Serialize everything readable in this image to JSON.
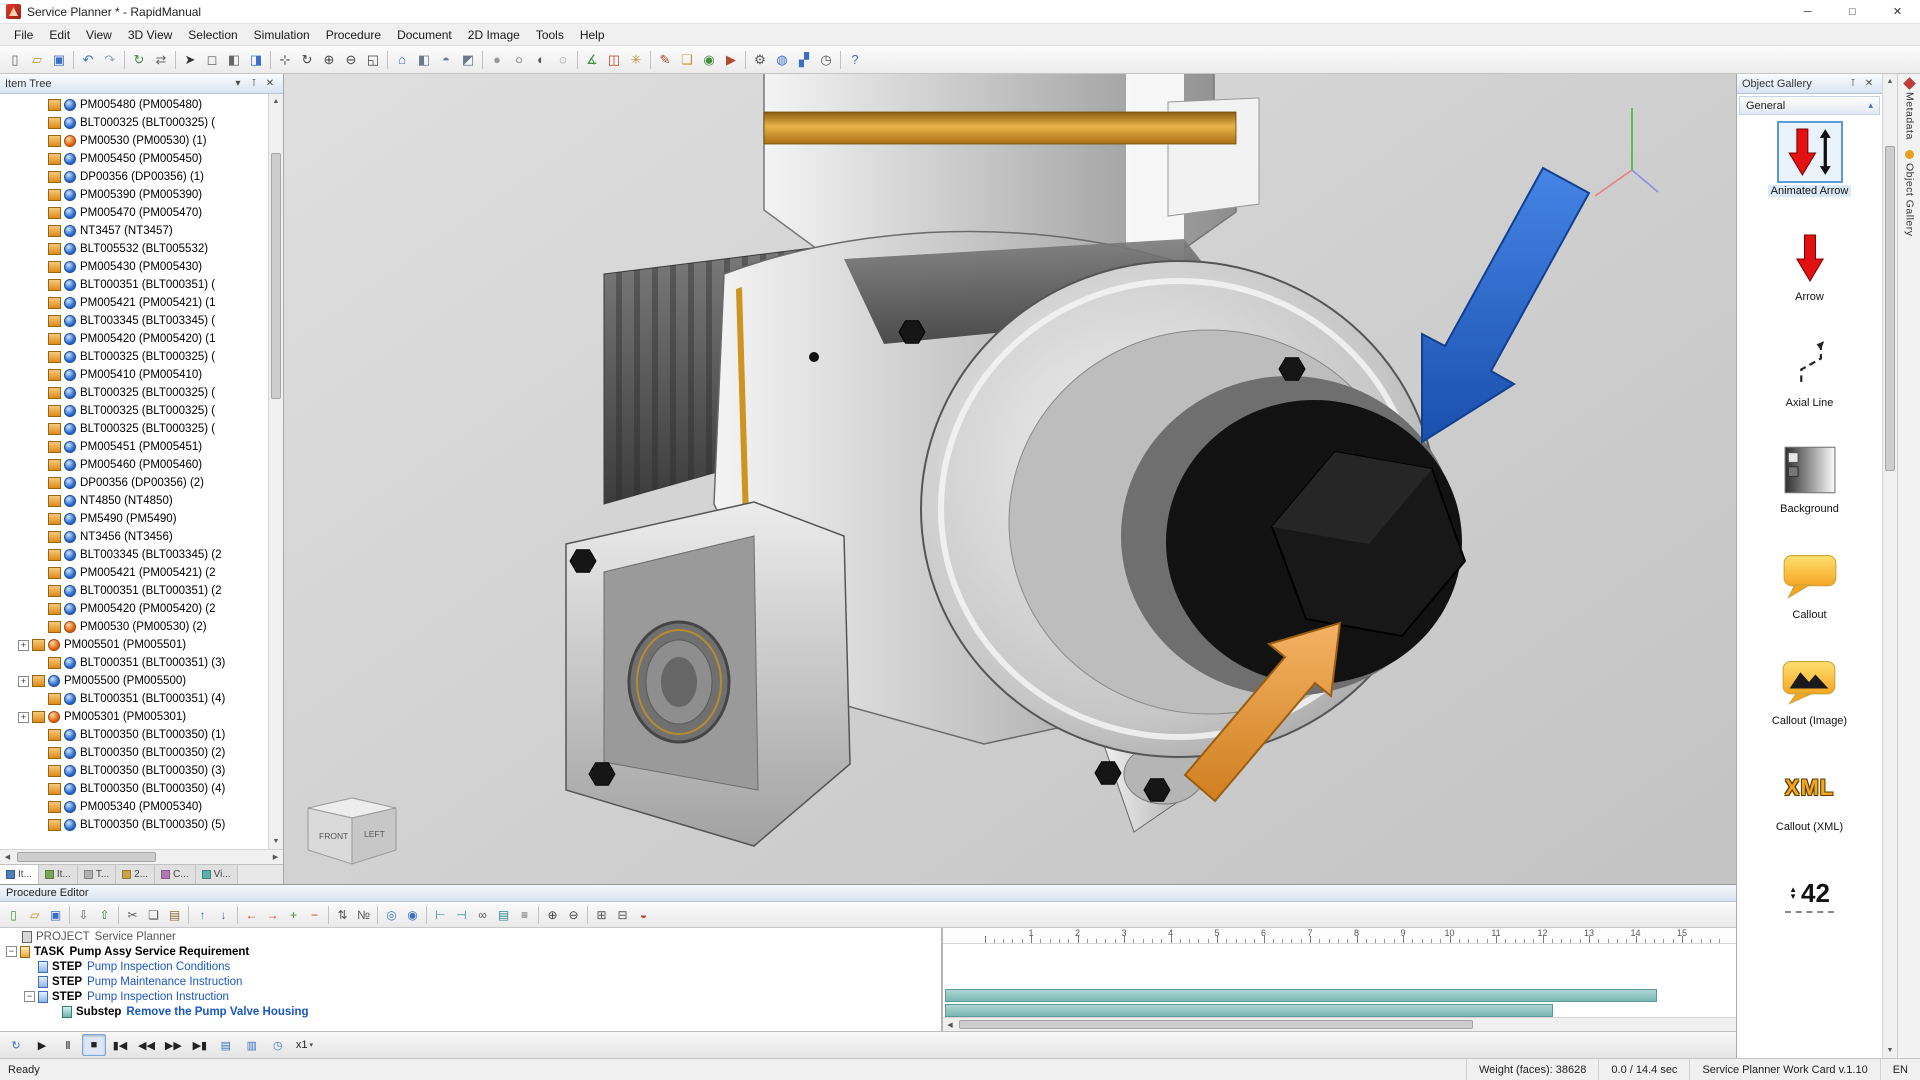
{
  "window": {
    "title": "Service Planner * - RapidManual",
    "controls": {
      "minimize": "─",
      "maximize": "□",
      "close": "✕"
    }
  },
  "menu": {
    "items": [
      "File",
      "Edit",
      "View",
      "3D View",
      "Selection",
      "Simulation",
      "Procedure",
      "Document",
      "2D Image",
      "Tools",
      "Help"
    ]
  },
  "main_toolbar": {
    "icons": [
      {
        "n": "new-document",
        "g": "▯",
        "c": "#666"
      },
      {
        "n": "open-file",
        "g": "▱",
        "c": "#c79136"
      },
      {
        "n": "save",
        "g": "▣",
        "c": "#3b6fc4"
      },
      {
        "sep": true
      },
      {
        "n": "undo",
        "g": "↶",
        "c": "#3b6fc4"
      },
      {
        "n": "redo",
        "g": "↷",
        "c": "#9aa7b8"
      },
      {
        "sep": true
      },
      {
        "n": "refresh",
        "g": "↻",
        "c": "#3f8f3f"
      },
      {
        "n": "sync",
        "g": "⇄",
        "c": "#666"
      },
      {
        "sep": true
      },
      {
        "n": "select-cursor",
        "g": "➤",
        "c": "#333"
      },
      {
        "n": "select-rectangle",
        "g": "◻",
        "c": "#666"
      },
      {
        "n": "select-group",
        "g": "◧",
        "c": "#666"
      },
      {
        "n": "select-by-color",
        "g": "◨",
        "c": "#3b6fc4"
      },
      {
        "sep": true
      },
      {
        "n": "pan",
        "g": "⊹",
        "c": "#444"
      },
      {
        "n": "orbit",
        "g": "↻",
        "c": "#444"
      },
      {
        "n": "zoom-in",
        "g": "⊕",
        "c": "#444"
      },
      {
        "n": "zoom-out",
        "g": "⊖",
        "c": "#444"
      },
      {
        "n": "zoom-fit",
        "g": "◱",
        "c": "#444"
      },
      {
        "sep": true
      },
      {
        "n": "view-home",
        "g": "⌂",
        "c": "#3b6fc4"
      },
      {
        "n": "view-front",
        "g": "◧",
        "c": "#6a7a8a"
      },
      {
        "n": "view-top",
        "g": "◓",
        "c": "#6a7a8a"
      },
      {
        "n": "view-iso",
        "g": "◩",
        "c": "#6a7a8a"
      },
      {
        "sep": true
      },
      {
        "n": "render-shaded",
        "g": "●",
        "c": "#9a9a9a"
      },
      {
        "n": "render-wireframe",
        "g": "○",
        "c": "#555"
      },
      {
        "n": "render-hidden-line",
        "g": "◐",
        "c": "#555"
      },
      {
        "n": "render-transparent",
        "g": "◌",
        "c": "#555"
      },
      {
        "sep": true
      },
      {
        "n": "measure",
        "g": "∡",
        "c": "#3f8f3f"
      },
      {
        "n": "section",
        "g": "◫",
        "c": "#b5482a"
      },
      {
        "n": "explode",
        "g": "✳",
        "c": "#c79136"
      },
      {
        "sep": true
      },
      {
        "n": "annotate",
        "g": "✎",
        "c": "#b5482a"
      },
      {
        "n": "callout",
        "g": "❏",
        "c": "#c79136"
      },
      {
        "n": "snapshot",
        "g": "◉",
        "c": "#3f8f3f"
      },
      {
        "n": "record-video",
        "g": "▶",
        "c": "#b5482a"
      },
      {
        "sep": true
      },
      {
        "n": "settings",
        "g": "⚙",
        "c": "#555"
      },
      {
        "n": "world",
        "g": "◍",
        "c": "#3b6fc4"
      },
      {
        "n": "chart",
        "g": "▞",
        "c": "#3b6fc4"
      },
      {
        "n": "timer",
        "g": "◷",
        "c": "#555"
      },
      {
        "sep": true
      },
      {
        "n": "help",
        "g": "?",
        "c": "#3b6fc4"
      }
    ]
  },
  "item_tree": {
    "title": "Item Tree",
    "header_icons": [
      {
        "n": "chevron-down",
        "g": "▾"
      },
      {
        "n": "pin",
        "g": "⊺"
      },
      {
        "n": "close",
        "g": "✕"
      }
    ],
    "items": [
      {
        "label": "PM005480 (PM005480)"
      },
      {
        "label": "BLT000325 (BLT000325) ("
      },
      {
        "label": "PM00530 (PM00530) (1)",
        "red": true
      },
      {
        "label": "PM005450 (PM005450)"
      },
      {
        "label": "DP00356 (DP00356) (1)"
      },
      {
        "label": "PM005390 (PM005390)"
      },
      {
        "label": "PM005470 (PM005470)"
      },
      {
        "label": "NT3457 (NT3457)"
      },
      {
        "label": "BLT005532 (BLT005532)"
      },
      {
        "label": "PM005430 (PM005430)"
      },
      {
        "label": "BLT000351 (BLT000351) ("
      },
      {
        "label": "PM005421 (PM005421) (1"
      },
      {
        "label": "BLT003345 (BLT003345) ("
      },
      {
        "label": "PM005420 (PM005420) (1"
      },
      {
        "label": "BLT000325 (BLT000325) ("
      },
      {
        "label": "PM005410 (PM005410)"
      },
      {
        "label": "BLT000325 (BLT000325) ("
      },
      {
        "label": "BLT000325 (BLT000325) ("
      },
      {
        "label": "BLT000325 (BLT000325) ("
      },
      {
        "label": "PM005451 (PM005451)"
      },
      {
        "label": "PM005460 (PM005460)"
      },
      {
        "label": "DP00356 (DP00356) (2)"
      },
      {
        "label": "NT4850 (NT4850)"
      },
      {
        "label": "PM5490 (PM5490)"
      },
      {
        "label": "NT3456 (NT3456)"
      },
      {
        "label": "BLT003345 (BLT003345) (2"
      },
      {
        "label": "PM005421 (PM005421) (2"
      },
      {
        "label": "BLT000351 (BLT000351) (2"
      },
      {
        "label": "PM005420 (PM005420) (2"
      },
      {
        "label": "PM00530 (PM00530) (2)",
        "red": true
      },
      {
        "label": "PM005501 (PM005501)",
        "plus": true,
        "lvl": 1,
        "red": true
      },
      {
        "label": "BLT000351 (BLT000351) (3)"
      },
      {
        "label": "PM005500 (PM005500)",
        "plus": true,
        "lvl": 1
      },
      {
        "label": "BLT000351 (BLT000351) (4)"
      },
      {
        "label": "PM005301 (PM005301)",
        "plus": true,
        "lvl": 1,
        "red": true
      },
      {
        "label": "BLT000350 (BLT000350) (1)"
      },
      {
        "label": "BLT000350 (BLT000350) (2)"
      },
      {
        "label": "BLT000350 (BLT000350) (3)"
      },
      {
        "label": "BLT000350 (BLT000350) (4)"
      },
      {
        "label": "PM005340 (PM005340)"
      },
      {
        "label": "BLT000350 (BLT000350) (5)"
      }
    ],
    "tabs": [
      {
        "label": "It...",
        "ic": "#4a7ebb",
        "active": true
      },
      {
        "label": "It...",
        "ic": "#7aa65a"
      },
      {
        "label": "T...",
        "ic": "#b0b0b0"
      },
      {
        "label": "2...",
        "ic": "#c7a44a"
      },
      {
        "label": "C...",
        "ic": "#b07ab0"
      },
      {
        "label": "Vi...",
        "ic": "#5ab0a6"
      }
    ]
  },
  "viewport": {
    "cube_front": "FRONT",
    "cube_left": "LEFT"
  },
  "object_gallery": {
    "title": "Object Gallery",
    "header_icons": [
      {
        "n": "pin",
        "g": "⊺"
      },
      {
        "n": "close",
        "g": "✕"
      }
    ],
    "group": "General",
    "collapse_glyph": "▴",
    "items": [
      {
        "label": "Animated Arrow",
        "icon": "animated-arrow",
        "selected": true
      },
      {
        "label": "Arrow",
        "icon": "arrow"
      },
      {
        "label": "Axial Line",
        "icon": "axial-line"
      },
      {
        "label": "Background",
        "icon": "background"
      },
      {
        "label": "Callout",
        "icon": "callout"
      },
      {
        "label": "Callout (Image)",
        "icon": "callout-image"
      },
      {
        "label": "Callout (XML)",
        "icon": "callout-xml",
        "icon_text": "XML"
      },
      {
        "label": "",
        "icon": "number",
        "icon_text": "42"
      }
    ],
    "side_tabs": [
      {
        "label": "Metadata",
        "ic": "#c23b3b",
        "shape": "diamond"
      },
      {
        "label": "Object Gallery",
        "ic": "#e8a020",
        "shape": "round"
      }
    ]
  },
  "procedure": {
    "title": "Procedure Editor",
    "toolbar": {
      "icons": [
        {
          "n": "new-procedure",
          "g": "▯",
          "c": "#3f8f3f"
        },
        {
          "n": "open-procedure",
          "g": "▱",
          "c": "#c79136"
        },
        {
          "n": "save-procedure",
          "g": "▣",
          "c": "#3b6fc4"
        },
        {
          "sep": true
        },
        {
          "n": "import",
          "g": "⇩",
          "c": "#666"
        },
        {
          "n": "export",
          "g": "⇧",
          "c": "#3f8f3f"
        },
        {
          "sep": true
        },
        {
          "n": "cut",
          "g": "✂",
          "c": "#555"
        },
        {
          "n": "copy",
          "g": "❏",
          "c": "#555"
        },
        {
          "n": "paste",
          "g": "▤",
          "c": "#8a6a3a"
        },
        {
          "sep": true
        },
        {
          "n": "move-up",
          "g": "↑",
          "c": "#3b6fc4"
        },
        {
          "n": "move-down",
          "g": "↓",
          "c": "#3b6fc4"
        },
        {
          "sep": true
        },
        {
          "n": "promote",
          "g": "←",
          "c": "#b5482a"
        },
        {
          "n": "demote",
          "g": "→",
          "c": "#b5482a"
        },
        {
          "n": "add-step",
          "g": "+",
          "c": "#3f8f3f"
        },
        {
          "n": "remove-step",
          "g": "−",
          "c": "#b5482a"
        },
        {
          "sep": true
        },
        {
          "n": "reorder",
          "g": "⇅",
          "c": "#555"
        },
        {
          "n": "renumber",
          "g": "№",
          "c": "#555"
        },
        {
          "sep": true
        },
        {
          "n": "find",
          "g": "◎",
          "c": "#3b6fc4"
        },
        {
          "n": "find-next",
          "g": "◉",
          "c": "#3b6fc4"
        },
        {
          "sep": true
        },
        {
          "n": "align-start",
          "g": "⊢",
          "c": "#2a8a8a"
        },
        {
          "n": "align-end",
          "g": "⊣",
          "c": "#2a8a8a"
        },
        {
          "n": "link-steps",
          "g": "∞",
          "c": "#555"
        },
        {
          "n": "gantt-view",
          "g": "▤",
          "c": "#2a8a8a"
        },
        {
          "n": "list-view",
          "g": "≡",
          "c": "#555"
        },
        {
          "sep": true
        },
        {
          "n": "zoom-timeline-in",
          "g": "⊕",
          "c": "#444"
        },
        {
          "n": "zoom-timeline-out",
          "g": "⊖",
          "c": "#444"
        },
        {
          "sep": true
        },
        {
          "n": "expand-all",
          "g": "⊞",
          "c": "#555"
        },
        {
          "n": "collapse-all",
          "g": "⊟",
          "c": "#555"
        },
        {
          "n": "color-settings",
          "g": "◒",
          "c": "#b5482a"
        }
      ]
    },
    "rows": [
      {
        "prefix": "PROJECT",
        "name": "Service Planner",
        "style": "project",
        "collapse": "",
        "icon": "proj-ic"
      },
      {
        "prefix": "TASK",
        "name": "Pump Assy Service Requirement",
        "style": "task",
        "collapse": "−",
        "icon": "task-ic"
      },
      {
        "prefix": "STEP",
        "name": "Pump Inspection Conditions",
        "style": "step",
        "collapse": "",
        "icon": "step-ic"
      },
      {
        "prefix": "STEP",
        "name": "Pump Maintenance Instruction",
        "style": "step",
        "collapse": "",
        "icon": "step-ic"
      },
      {
        "prefix": "STEP",
        "name": "Pump Inspection Instruction",
        "style": "step",
        "collapse": "−",
        "icon": "step-ic"
      },
      {
        "prefix": "Substep",
        "name": "Remove the Pump Valve Housing",
        "style": "substep",
        "collapse": "",
        "icon": "sub-ic"
      }
    ],
    "timeline": {
      "ticks": [
        "1",
        "2",
        "3",
        "4",
        "5",
        "6",
        "7",
        "8",
        "9",
        "10",
        "11",
        "12",
        "13",
        "14",
        "15"
      ],
      "bars": [
        {
          "row": 4,
          "width_pct": 90.5
        },
        {
          "row": 5,
          "width_pct": 77.4
        }
      ]
    }
  },
  "playback": {
    "icons": [
      {
        "n": "loop",
        "g": "↻",
        "c": "#3b6fc4"
      },
      {
        "n": "play",
        "g": "▶"
      },
      {
        "n": "pause",
        "g": "Ⅱ"
      },
      {
        "n": "stop",
        "g": "■",
        "active": true
      },
      {
        "n": "go-start",
        "g": "▮◀"
      },
      {
        "n": "step-back",
        "g": "◀◀"
      },
      {
        "n": "step-forward",
        "g": "▶▶"
      },
      {
        "n": "go-end",
        "g": "▶▮"
      },
      {
        "n": "capture-frame",
        "g": "▤",
        "c": "#3b6fc4"
      },
      {
        "n": "capture-sequence",
        "g": "▥",
        "c": "#3b6fc4"
      },
      {
        "n": "time-mode",
        "g": "◷",
        "c": "#3b6fc4"
      },
      {
        "n": "speed",
        "g": "x1",
        "caret": true
      }
    ]
  },
  "status": {
    "ready": "Ready",
    "weight": "Weight (faces): 38628",
    "time": "0.0 / 14.4 sec",
    "app": "Service Planner Work Card v.1.10",
    "lang": "EN"
  }
}
